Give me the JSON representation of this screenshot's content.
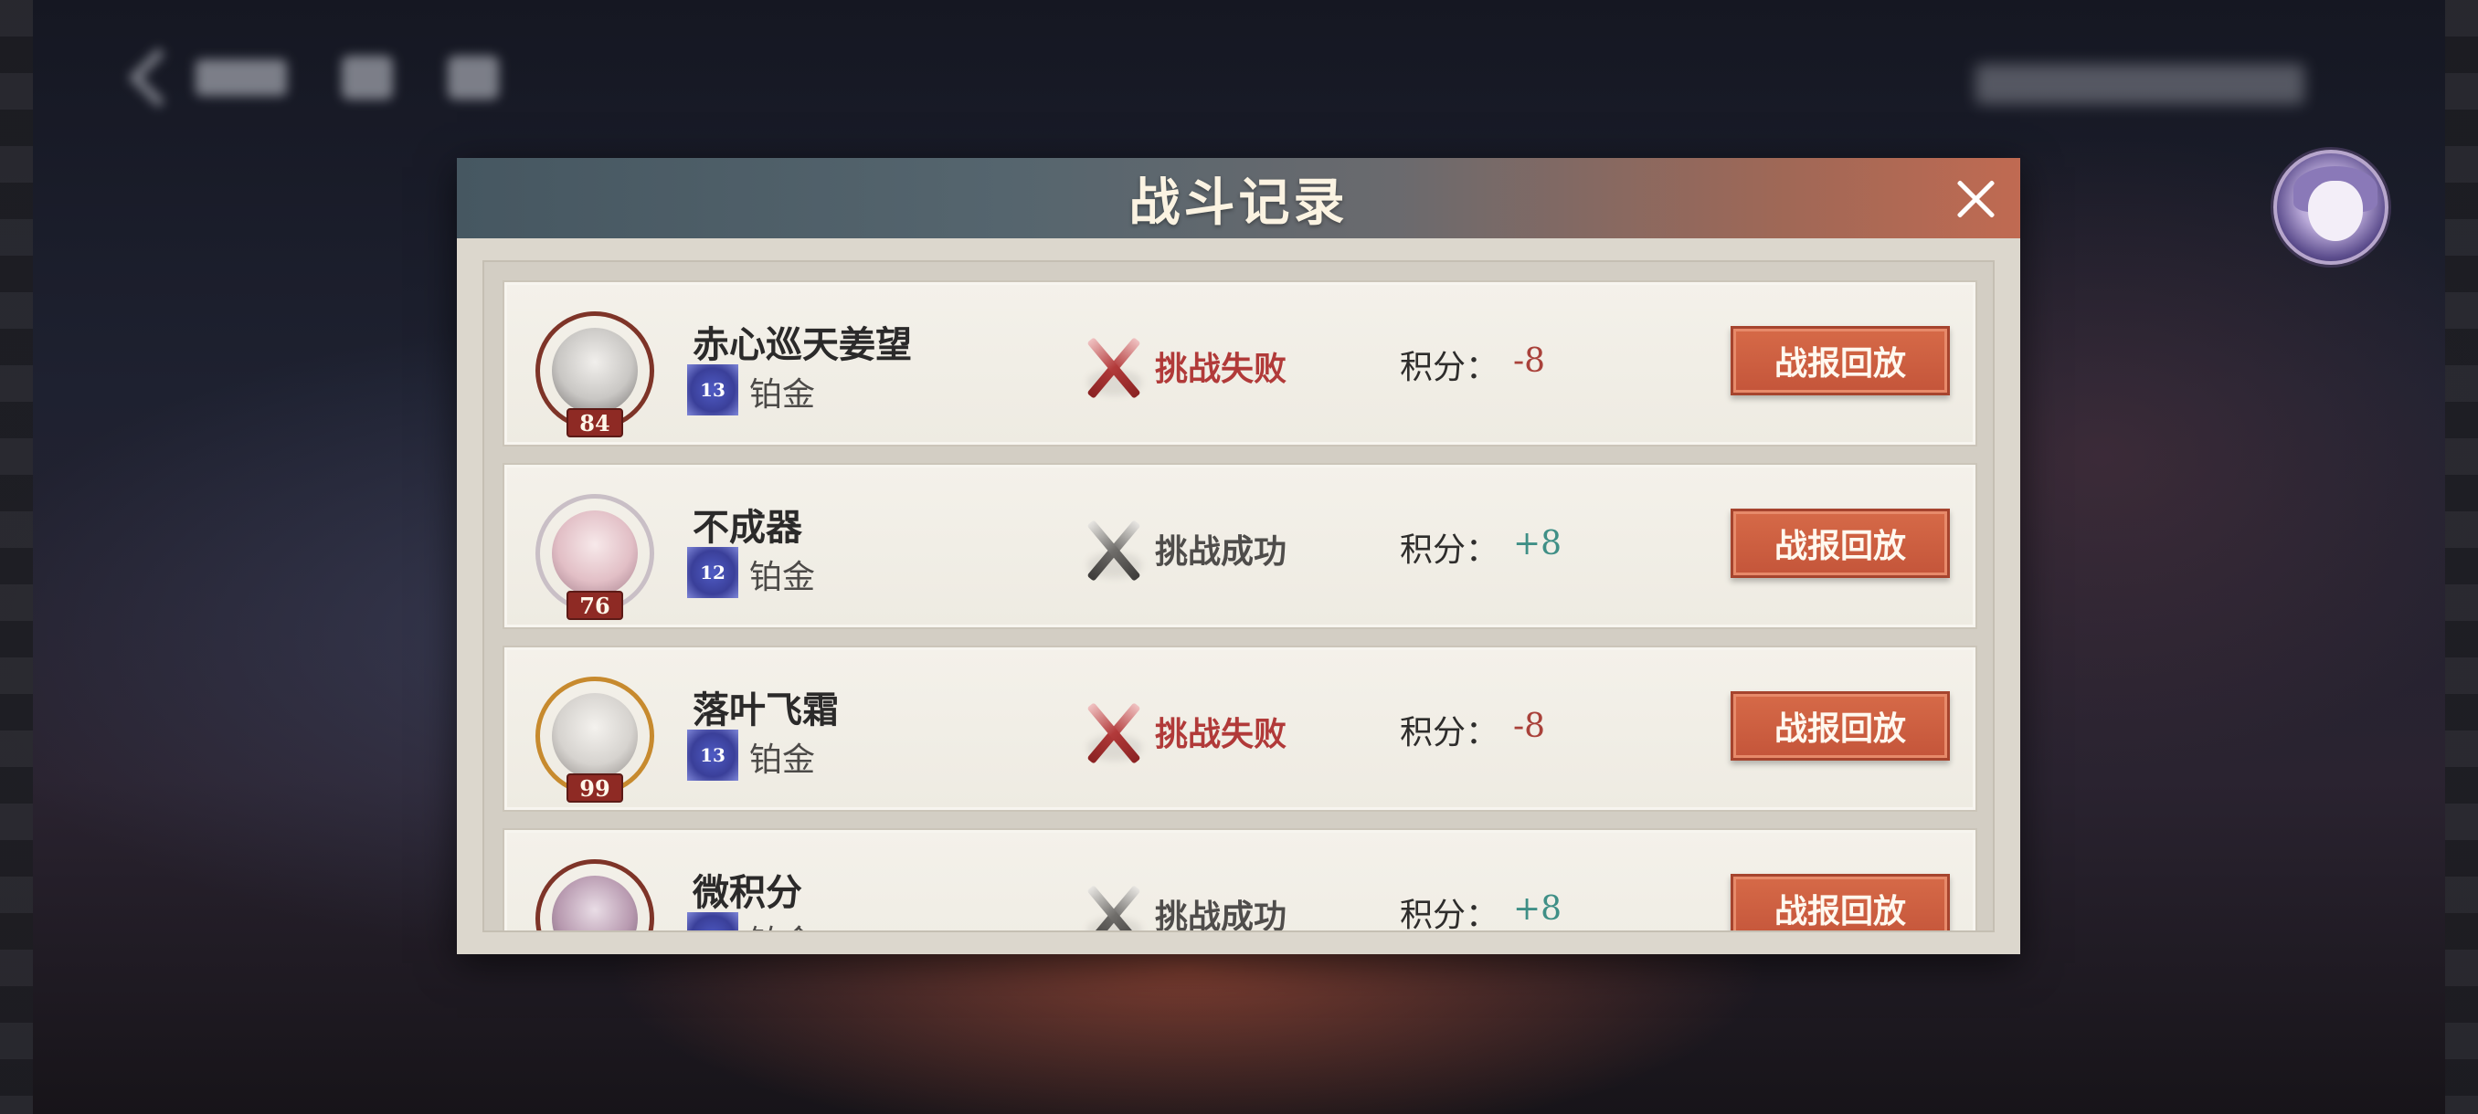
{
  "modal": {
    "title": "战斗记录"
  },
  "records": [
    {
      "name": "赤心巡天姜望",
      "level": "84",
      "rank_num": "13",
      "rank": "铂金",
      "result": "挑战失败",
      "score_label": "积分：",
      "score": "-8",
      "replay_label": "战报回放"
    },
    {
      "name": "不成器",
      "level": "76",
      "rank_num": "12",
      "rank": "铂金",
      "result": "挑战成功",
      "score_label": "积分：",
      "score": "+8",
      "replay_label": "战报回放"
    },
    {
      "name": "落叶飞霜",
      "level": "99",
      "rank_num": "13",
      "rank": "铂金",
      "result": "挑战失败",
      "score_label": "积分：",
      "score": "-8",
      "replay_label": "战报回放"
    },
    {
      "name": "微积分",
      "level": "",
      "rank_num": "",
      "rank": "铂金",
      "result": "挑战成功",
      "score_label": "积分：",
      "score": "+8",
      "replay_label": "战报回放"
    }
  ],
  "icons": {
    "close": "close-icon",
    "lose": "crossed-swords-red-icon",
    "win": "crossed-swords-gray-icon",
    "rank": "rank-emblem-icon"
  },
  "colors": {
    "lose": "#b13a39",
    "win": "#4f4d4b",
    "score_negative": "#a9413a",
    "score_positive": "#3f8f86",
    "replay_button": "#cf5f41",
    "header_left": "#465761",
    "header_right": "#c06a52"
  }
}
